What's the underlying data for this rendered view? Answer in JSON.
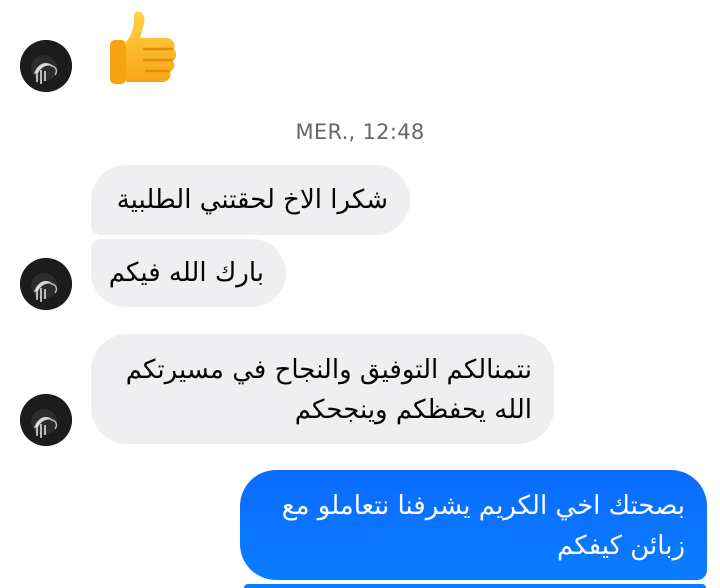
{
  "thread": {
    "timestamp": "MER., 12:48",
    "messages": [
      {
        "direction": "incoming",
        "type": "emoji",
        "emoji": "thumbs-up"
      },
      {
        "direction": "incoming",
        "lines": [
          "شكرا الاخ لحقتني الطلبية"
        ]
      },
      {
        "direction": "incoming",
        "lines": [
          "بارك الله فيكم"
        ]
      },
      {
        "direction": "incoming",
        "lines": [
          "نتمنالكم التوفيق والنجاح في مسيرتكم",
          "الله يحفظكم وينجحكم"
        ]
      },
      {
        "direction": "outgoing",
        "lines": [
          "بصحتك اخي الكريم يشرفنا نتعاملو مع",
          "زبائن كيفكم"
        ]
      }
    ]
  },
  "colors": {
    "incoming_bubble": "#efeff1",
    "outgoing_bubble": "#0a7cff",
    "timestamp_text": "#65676b"
  },
  "icons": {
    "avatar": "avatar-image",
    "reaction": "thumbs-up-icon"
  }
}
